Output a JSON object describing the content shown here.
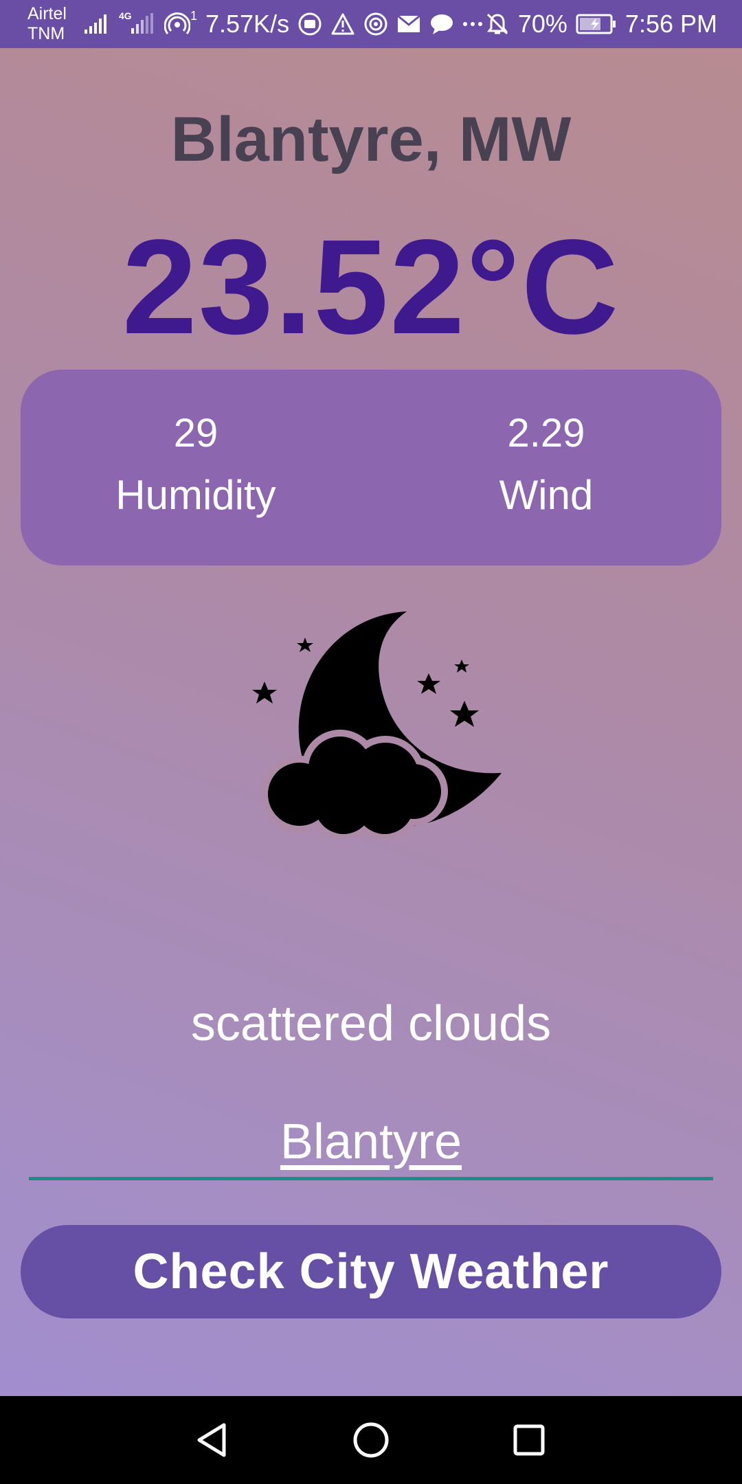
{
  "status_bar": {
    "carrier_line1": "Airtel",
    "carrier_line2": "TNM",
    "network_label": "4G",
    "hotspot_count": "1",
    "speed": "7.57K/s",
    "battery_percent": "70%",
    "time": "7:56 PM",
    "icons": [
      "signal-icon",
      "lte-signal-icon",
      "hotspot-icon",
      "screen-record-icon",
      "warning-icon",
      "wireless-icon",
      "mail-icon",
      "chat-icon",
      "more-icon",
      "mute-icon",
      "battery-icon"
    ]
  },
  "weather": {
    "city": "Blantyre, MW",
    "temperature": "23.52°C",
    "humidity_value": "29",
    "humidity_label": "Humidity",
    "wind_value": "2.29",
    "wind_label": "Wind",
    "icon": "moon-cloud-stars-icon",
    "description": "scattered clouds"
  },
  "search": {
    "value": "Blantyre"
  },
  "actions": {
    "check_label": "Check City Weather"
  },
  "nav": {
    "icons": [
      "back-icon",
      "home-icon",
      "recents-icon"
    ]
  },
  "colors": {
    "status_bar": "#6a4ea6",
    "temperature": "#3f1a8e",
    "card": "#8d66b0",
    "button": "#6650a6",
    "input_underline": "#1f8a86"
  }
}
